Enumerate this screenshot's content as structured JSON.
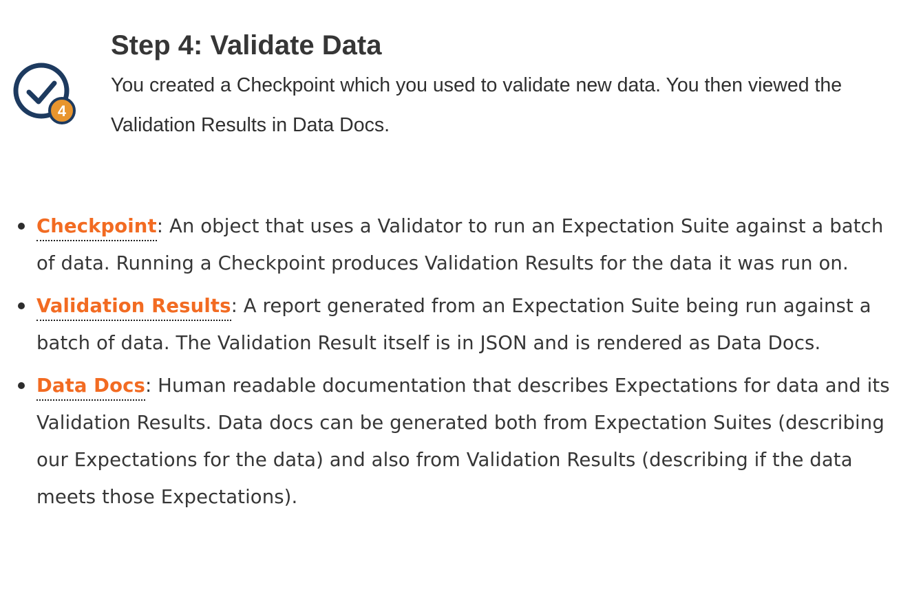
{
  "step": {
    "title": "Step 4: Validate Data",
    "description": "You created a Checkpoint which you used to validate new data. You then viewed the Validation Results in Data Docs.",
    "icon": "checkmark-circle-step-icon",
    "badge_number": "4"
  },
  "colors": {
    "link_orange": "#f26b22",
    "icon_navy": "#1d3a5f",
    "badge_gold": "#e8952e",
    "text": "#363636"
  },
  "terms": [
    {
      "term": "Checkpoint",
      "definition": ": An object that uses a Validator to run an Expectation Suite against a batch of data. Running a Checkpoint produces Validation Results for the data it was run on."
    },
    {
      "term": "Validation Results",
      "definition": ": A report generated from an Expectation Suite being run against a batch of data. The Validation Result itself is in JSON and is rendered as Data Docs."
    },
    {
      "term": "Data Docs",
      "definition": ": Human readable documentation that describes Expectations for data and its Validation Results. Data docs can be generated both from Expectation Suites (describing our Expectations for the data) and also from Validation Results (describing if the data meets those Expectations)."
    }
  ]
}
